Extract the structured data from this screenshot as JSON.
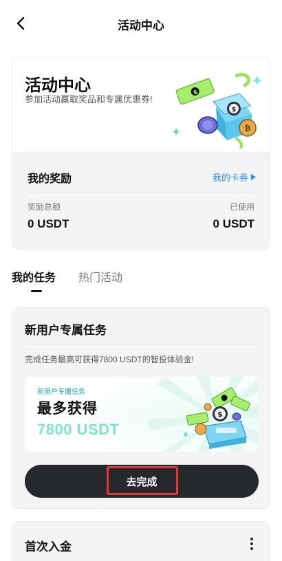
{
  "header": {
    "title": "活动中心"
  },
  "hero": {
    "title": "活动中心",
    "subtitle": "参加活动赢取奖品和专属优惠券!"
  },
  "rewards": {
    "title": "我的奖励",
    "link_label": "我的卡券",
    "total_label": "奖励总额",
    "total_value": "0 USDT",
    "used_label": "已使用",
    "used_value": "0 USDT"
  },
  "tabs": [
    {
      "label": "我的任务",
      "active": true
    },
    {
      "label": "热门活动",
      "active": false
    }
  ],
  "task": {
    "title": "新用户专属任务",
    "description": "完成任务最高可获得7800 USDT的智投体验金!",
    "promo": {
      "tag": "新用户专属任务",
      "headline": "最多获得",
      "amount": "7800 USDT"
    },
    "cta_label": "去完成"
  },
  "task2": {
    "title": "首次入金"
  },
  "colors": {
    "accent_link": "#2c8de8",
    "cta_bg": "#25282c",
    "promo_amount": "#7fe3c9",
    "highlight": "#e53935"
  },
  "icons": {
    "back": "chevron-left-icon",
    "link_arrow": "triangle-right-icon",
    "more": "more-vertical-icon"
  }
}
